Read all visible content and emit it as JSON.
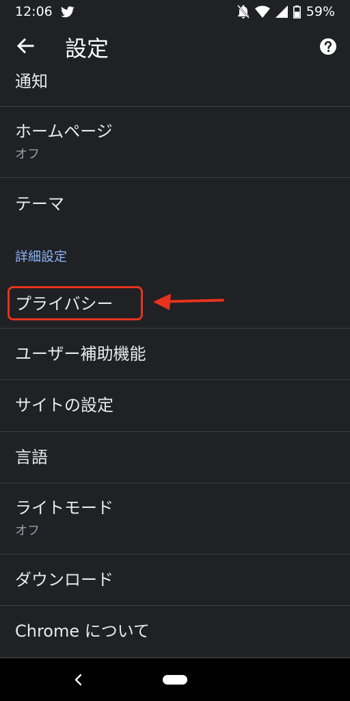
{
  "status_bar": {
    "time": "12:06",
    "battery": "59%"
  },
  "header": {
    "title": "設定"
  },
  "items": [
    {
      "label": "通知"
    },
    {
      "label": "ホームページ",
      "sub": "オフ"
    },
    {
      "label": "テーマ"
    }
  ],
  "section": {
    "title": "詳細設定"
  },
  "advanced_items": [
    {
      "label": "プライバシー"
    },
    {
      "label": "ユーザー補助機能"
    },
    {
      "label": "サイトの設定"
    },
    {
      "label": "言語"
    },
    {
      "label": "ライトモード",
      "sub": "オフ"
    },
    {
      "label": "ダウンロード"
    },
    {
      "label": "Chrome について"
    }
  ],
  "colors": {
    "background": "#202124",
    "accent": "#8ab4f8",
    "annotation": "#e8321e"
  },
  "icons": {
    "status": [
      "twitter-icon",
      "notifications-off-icon",
      "wifi-icon",
      "signal-icon",
      "battery-icon"
    ],
    "app_bar": [
      "arrow-back-icon",
      "help-icon"
    ],
    "nav": [
      "nav-back-icon",
      "home-pill"
    ]
  }
}
